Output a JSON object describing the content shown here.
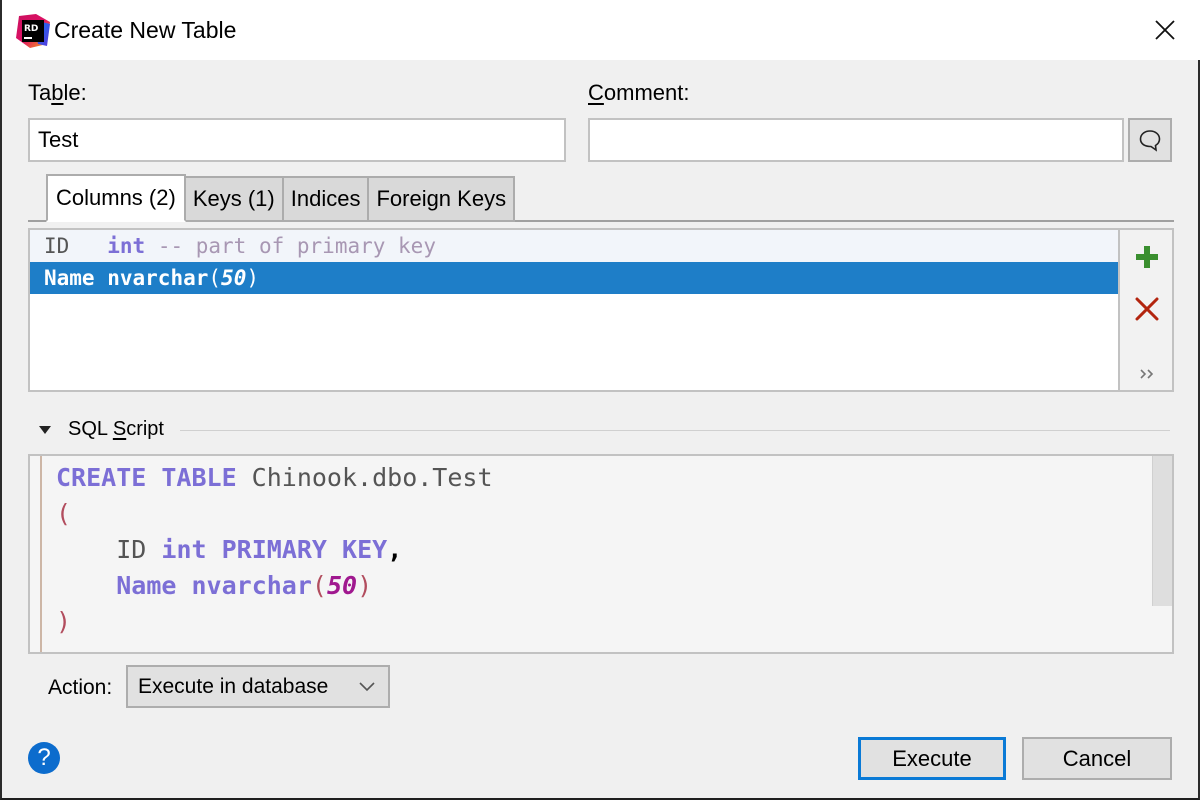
{
  "window": {
    "title": "Create New Table",
    "app_icon": "rider-rd-logo-icon",
    "close_icon": "close-icon"
  },
  "form": {
    "table_label_pre": "Ta",
    "table_label_u": "b",
    "table_label_post": "le:",
    "table_value": "Test",
    "comment_label_u": "C",
    "comment_label_post": "omment:",
    "comment_value": "",
    "comment_button_icon": "speech-bubble-icon"
  },
  "tabs": [
    {
      "label": "Columns (2)",
      "active": true
    },
    {
      "label": "Keys (1)",
      "active": false
    },
    {
      "label": "Indices",
      "active": false
    },
    {
      "label": "Foreign Keys",
      "active": false
    }
  ],
  "columns": {
    "rows": [
      {
        "name": "ID  ",
        "type": "int",
        "comment": " -- part of primary key",
        "selected": false
      },
      {
        "name": "Name",
        "type": "nvarchar",
        "len": "50",
        "selected": true
      }
    ],
    "tools": {
      "add_icon": "plus-icon",
      "remove_icon": "delete-x-icon",
      "more_icon": "double-chevron-right-icon"
    }
  },
  "sql_section": {
    "title_pre": "SQL ",
    "title_u": "S",
    "title_post": "cript",
    "expanded": true,
    "code": {
      "line1_kw": "CREATE TABLE",
      "line1_name": " Chinook.dbo.Test",
      "line2": "(",
      "line3_indent": "    ",
      "line3_id": "ID",
      "line3_type": "int",
      "line3_kw": "PRIMARY KEY",
      "line3_comma": ",",
      "line4_name": "Name",
      "line4_type": "nvarchar",
      "line4_open": "(",
      "line4_len": "50",
      "line4_close": ")",
      "line5": ")"
    }
  },
  "action": {
    "label": "Action:",
    "selected": "Execute in database"
  },
  "buttons": {
    "execute": "Execute",
    "cancel": "Cancel",
    "help": "?"
  },
  "colors": {
    "selection": "#1e7ec8",
    "keyword": "#7c6fd6",
    "number": "#a0188f",
    "paren": "#b24d5e",
    "default_button_border": "#0a7ad6",
    "add": "#3a8f2f",
    "remove": "#b3250f",
    "help": "#0c6ccd"
  }
}
